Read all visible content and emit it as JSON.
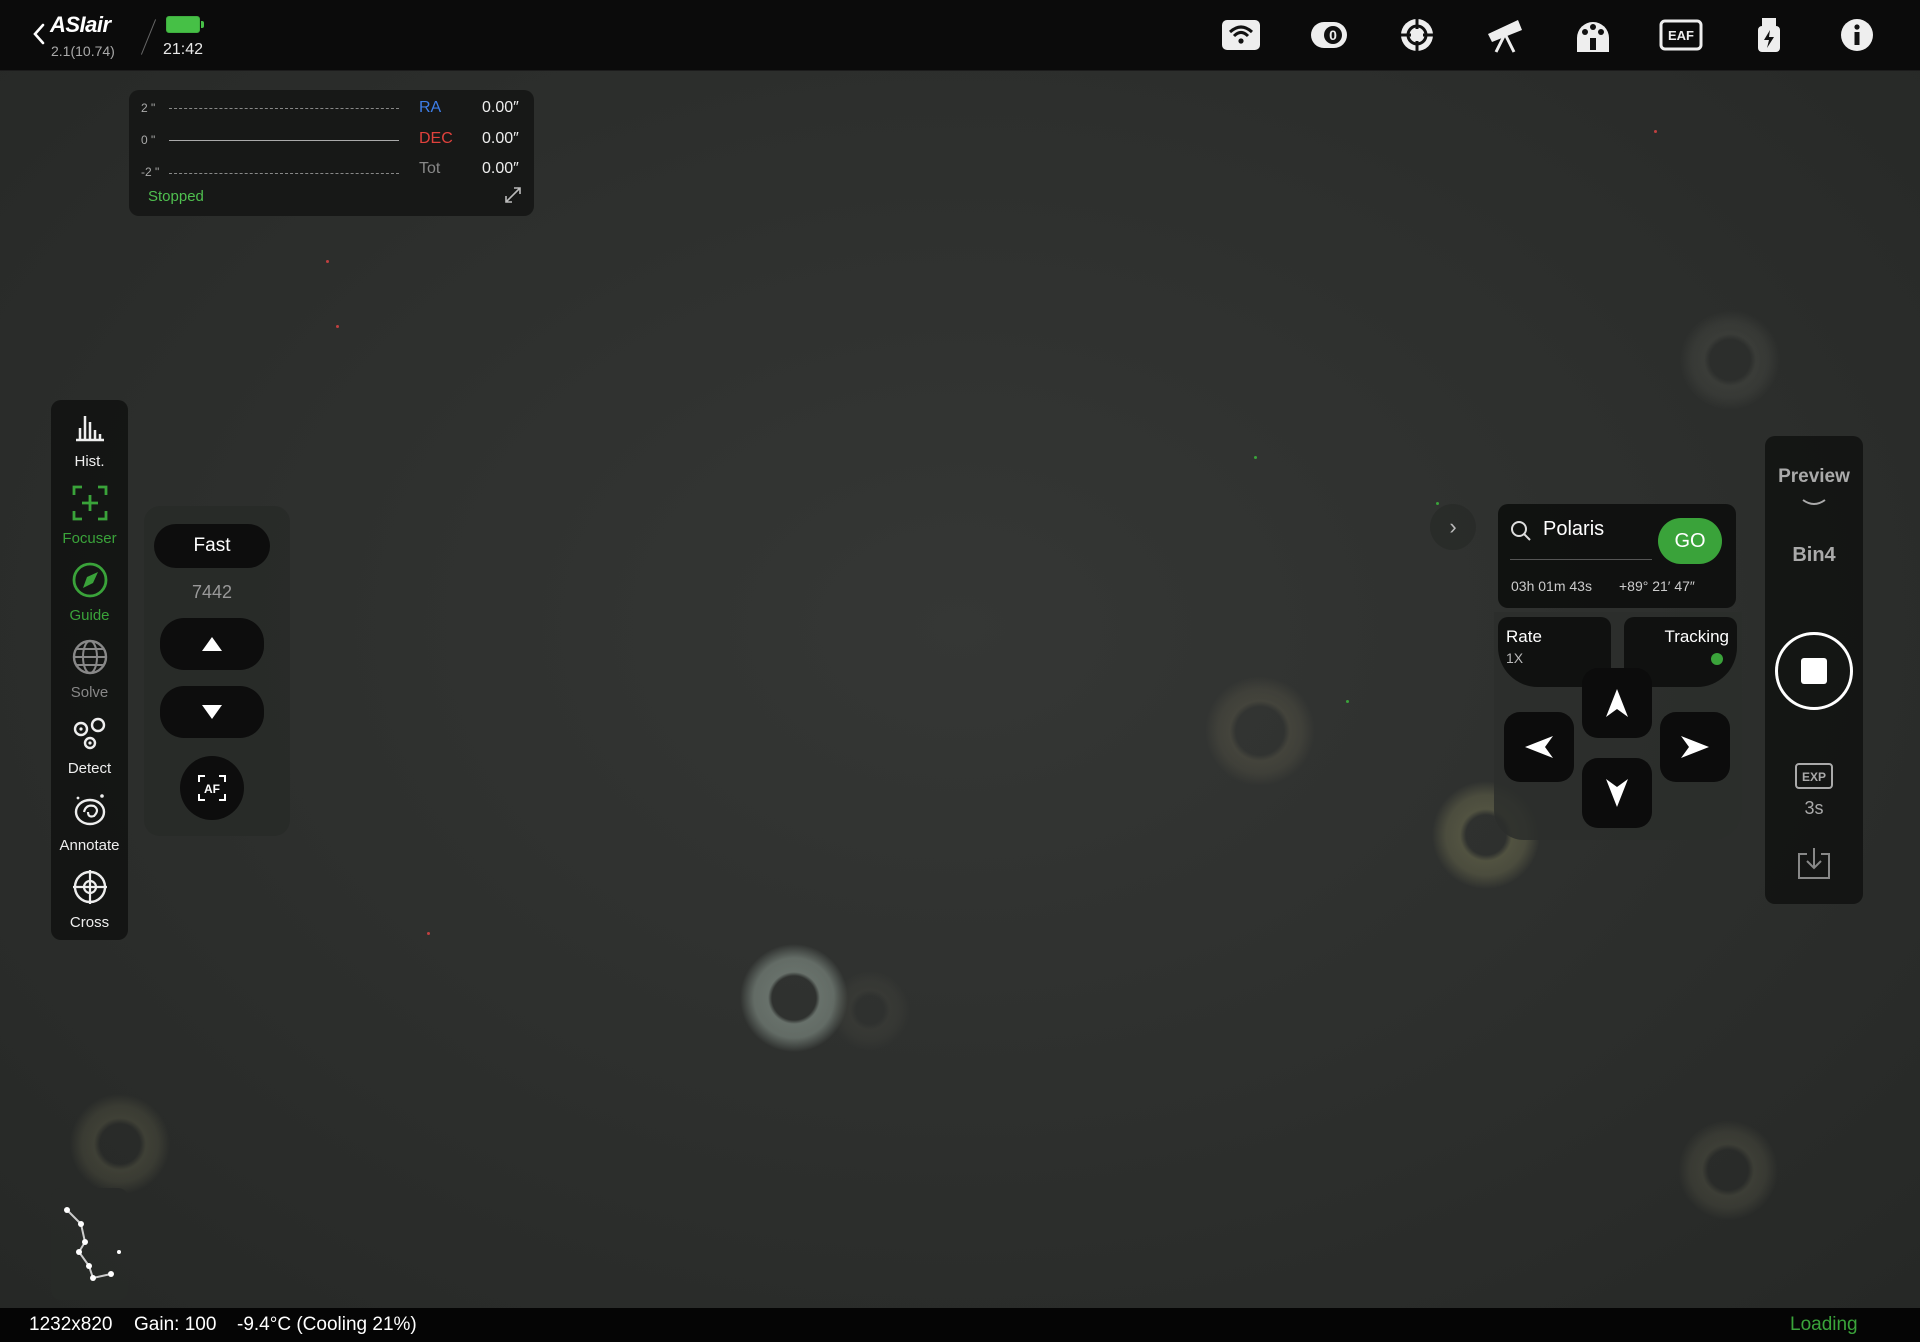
{
  "header": {
    "app_name": "ASIair",
    "version": "2.1(10.74)",
    "time": "21:42"
  },
  "top_icons": [
    "wifi-icon",
    "camera-icon",
    "guide-scope-icon",
    "telescope-icon",
    "filter-wheel-icon",
    "eaf-icon",
    "usb-power-icon",
    "info-icon"
  ],
  "top_icon_text": {
    "camera_badge": "0",
    "eaf": "EAF"
  },
  "guide_graph": {
    "y_ticks": [
      "2 \"",
      "0 \"",
      "-2 \""
    ],
    "ra_label": "RA",
    "ra_value": "0.00″",
    "dec_label": "DEC",
    "dec_value": "0.00″",
    "tot_label": "Tot",
    "tot_value": "0.00″",
    "status": "Stopped",
    "colors": {
      "ra": "#3d7ee8",
      "dec": "#e0413c",
      "status": "#4fbf4f"
    }
  },
  "toolbar": {
    "items": [
      {
        "label": "Hist.",
        "icon": "histogram-icon",
        "active": false
      },
      {
        "label": "Focuser",
        "icon": "focuser-icon",
        "active": true
      },
      {
        "label": "Guide",
        "icon": "guide-icon",
        "active": true
      },
      {
        "label": "Solve",
        "icon": "globe-icon",
        "active": false
      },
      {
        "label": "Detect",
        "icon": "detect-stars-icon",
        "active": false
      },
      {
        "label": "Annotate",
        "icon": "galaxy-icon",
        "active": false
      },
      {
        "label": "Cross",
        "icon": "crosshair-icon",
        "active": false
      }
    ]
  },
  "focuser": {
    "speed": "Fast",
    "position": "7442",
    "af_label": "AF"
  },
  "mount": {
    "target": "Polaris",
    "go_label": "GO",
    "ra": "03h 01m 43s",
    "dec": "+89° 21′ 47″",
    "rate_label": "Rate",
    "rate_value": "1X",
    "tracking_label": "Tracking",
    "tracking_on": true
  },
  "capture": {
    "mode": "Preview",
    "bin": "Bin4",
    "exp_label": "EXP",
    "exposure": "3s"
  },
  "status": {
    "resolution": "1232x820",
    "gain": "Gain: 100",
    "temperature": "-9.4°C (Cooling 21%)",
    "state": "Loading"
  },
  "accent": "#3aa33a"
}
